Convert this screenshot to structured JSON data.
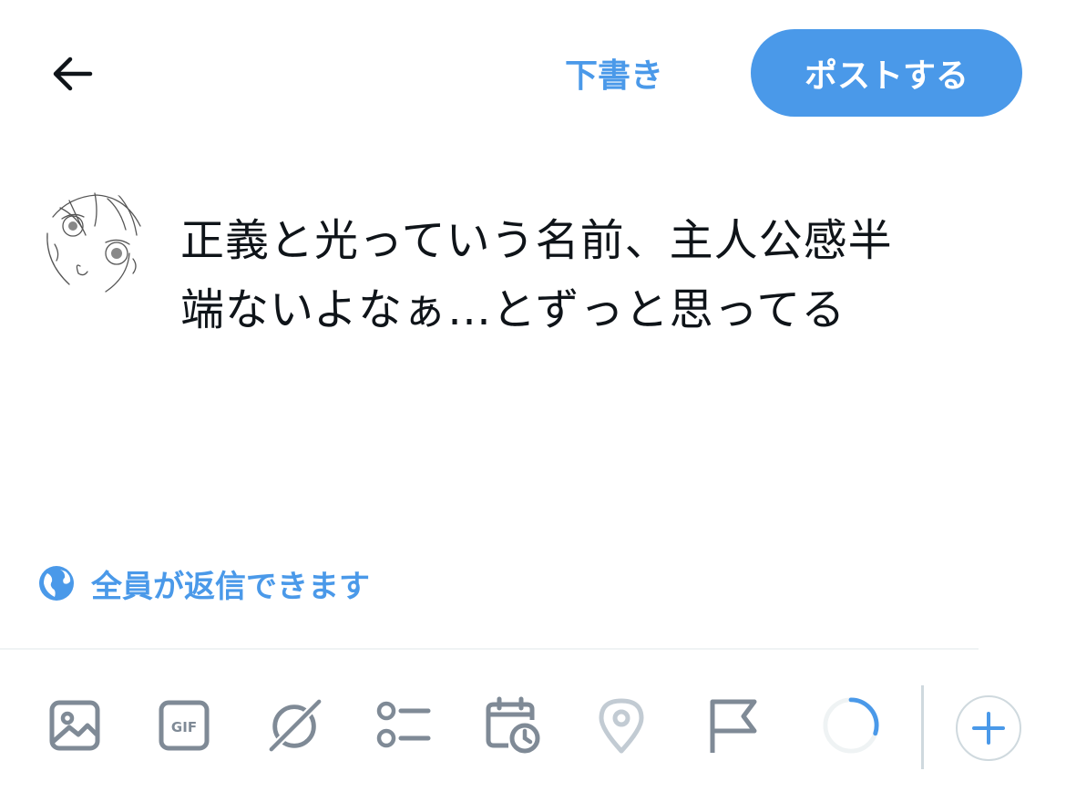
{
  "header": {
    "back_icon": "arrow-left-icon",
    "drafts_label": "下書き",
    "post_label": "ポストする"
  },
  "composer": {
    "avatar": "sketch-avatar",
    "text_lines": [
      "正義と光っていう名前、主人公感半",
      "端ないよなぁ…とずっと思ってる"
    ]
  },
  "reply_setting": {
    "icon": "globe-icon",
    "label": "全員が返信できます"
  },
  "toolbar": {
    "icons": [
      "image-icon",
      "gif-icon",
      "grok-icon",
      "poll-icon",
      "schedule-icon",
      "location-icon",
      "flag-icon"
    ],
    "gif_text": "GIF",
    "char_progress": 0.3,
    "add_icon": "plus-icon"
  },
  "colors": {
    "accent": "#4a99e9",
    "icon_gray": "#7f8a96",
    "disabled_gray": "#c2cbd3",
    "divider": "#eff3f4"
  }
}
